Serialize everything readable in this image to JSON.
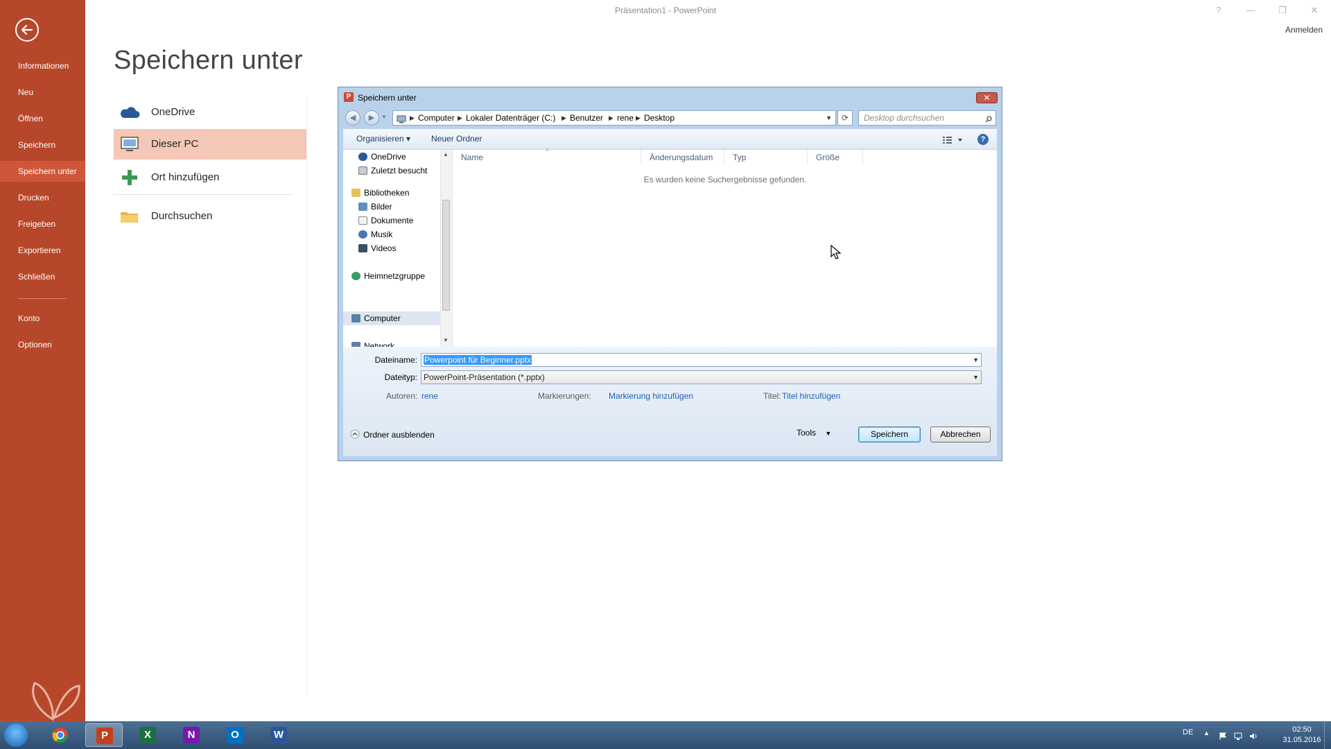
{
  "window": {
    "title": "Präsentation1 - PowerPoint",
    "controls": [
      "?",
      "—",
      "❐",
      "✕"
    ],
    "sign_in": "Anmelden"
  },
  "backstage": {
    "items": [
      {
        "label": "Informationen"
      },
      {
        "label": "Neu"
      },
      {
        "label": "Öffnen"
      },
      {
        "label": "Speichern"
      },
      {
        "label": "Speichern unter",
        "active": true
      },
      {
        "label": "Drucken"
      },
      {
        "label": "Freigeben"
      },
      {
        "label": "Exportieren"
      },
      {
        "label": "Schließen"
      },
      {
        "label": "Konto"
      },
      {
        "label": "Optionen"
      }
    ],
    "accent": "#b7472a"
  },
  "save_as": {
    "title": "Speichern unter",
    "locations": [
      {
        "label": "OneDrive",
        "icon": "cloud-icon"
      },
      {
        "label": "Dieser PC",
        "icon": "computer-icon",
        "active": true
      },
      {
        "label": "Ort hinzufügen",
        "icon": "plus-icon"
      },
      {
        "label": "Durchsuchen",
        "icon": "folder-icon"
      }
    ]
  },
  "dialog": {
    "title": "Speichern unter",
    "close": "✕",
    "breadcrumb": [
      "Computer",
      "Lokaler Datenträger (C:)",
      "Benutzer",
      "rene",
      "Desktop"
    ],
    "search_placeholder": "Desktop durchsuchen",
    "toolbar": {
      "organize": "Organisieren ▾",
      "new_folder": "Neuer Ordner"
    },
    "tree": [
      {
        "label": "OneDrive",
        "icon": "cloud-icon"
      },
      {
        "label": "Zuletzt besucht",
        "icon": "recent-icon"
      },
      {
        "label": "Bibliotheken",
        "icon": "library-icon"
      },
      {
        "label": "Bilder",
        "icon": "pictures-icon"
      },
      {
        "label": "Dokumente",
        "icon": "documents-icon"
      },
      {
        "label": "Musik",
        "icon": "music-icon"
      },
      {
        "label": "Videos",
        "icon": "videos-icon"
      },
      {
        "label": "Heimnetzgruppe",
        "icon": "homegroup-icon"
      },
      {
        "label": "Computer",
        "icon": "computer-icon"
      },
      {
        "label": "Network",
        "icon": "network-icon"
      }
    ],
    "columns": [
      "Name",
      "Änderungsdatum",
      "Typ",
      "Größe"
    ],
    "empty_message": "Es wurden keine Suchergebnisse gefunden.",
    "filename_label": "Dateiname:",
    "filename_value": "Powerpoint für Beginner.pptx",
    "filetype_label": "Dateityp:",
    "filetype_value": "PowerPoint-Präsentation (*.pptx)",
    "authors_label": "Autoren:",
    "authors_value": "rene",
    "tags_label": "Markierungen:",
    "tags_value": "Markierung hinzufügen",
    "title_label": "Titel:",
    "title_value": "Titel hinzufügen",
    "hide_folders": "Ordner ausblenden",
    "tools": "Tools",
    "save": "Speichern",
    "cancel": "Abbrechen"
  },
  "taskbar": {
    "apps": [
      {
        "name": "chrome-icon",
        "active": false
      },
      {
        "name": "powerpoint-icon",
        "glyph": "P",
        "active": true,
        "color": "#c43e1c"
      },
      {
        "name": "excel-icon",
        "glyph": "X",
        "active": false,
        "color": "#1d6f42"
      },
      {
        "name": "onenote-icon",
        "glyph": "N",
        "active": false,
        "color": "#7719aa"
      },
      {
        "name": "outlook-icon",
        "glyph": "O",
        "active": false,
        "color": "#0072c6"
      },
      {
        "name": "word-icon",
        "glyph": "W",
        "active": false,
        "color": "#2b579a"
      }
    ],
    "language": "DE",
    "time": "02:50",
    "date": "31.05.2016"
  }
}
